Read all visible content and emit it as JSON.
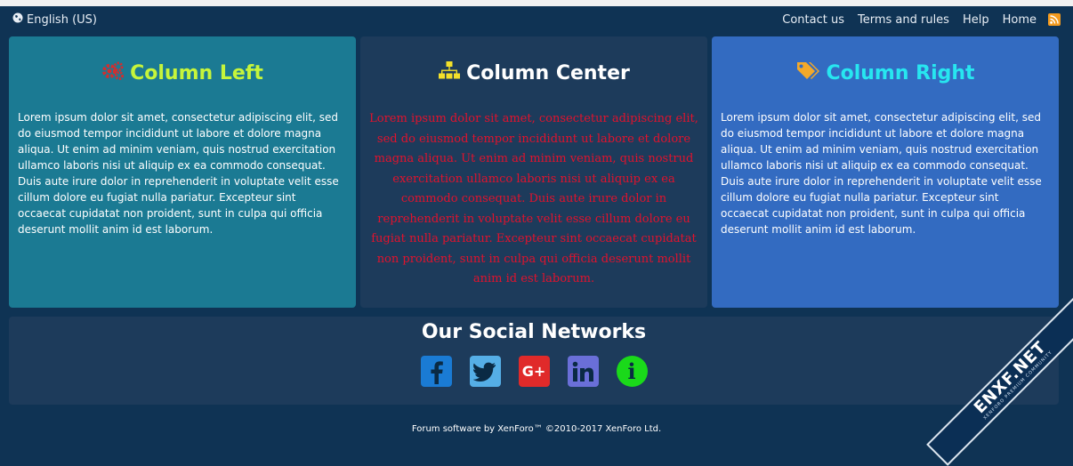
{
  "topbar": {
    "language": "English (US)",
    "links": [
      "Contact us",
      "Terms and rules",
      "Help",
      "Home"
    ]
  },
  "columns": {
    "left": {
      "title": "Column Left",
      "icon": "gears-icon",
      "text": "Lorem ipsum dolor sit amet, consectetur adipiscing elit, sed do eiusmod tempor incididunt ut labore et dolore magna aliqua. Ut enim ad minim veniam, quis nostrud exercitation ullamco laboris nisi ut aliquip ex ea commodo consequat. Duis aute irure dolor in reprehenderit in voluptate velit esse cillum dolore eu fugiat nulla pariatur. Excepteur sint occaecat cupidatat non proident, sunt in culpa qui officia deserunt mollit anim id est laborum."
    },
    "center": {
      "title": "Column Center",
      "icon": "sitemap-icon",
      "text": "Lorem ipsum dolor sit amet, consectetur adipiscing elit, sed do eiusmod tempor incididunt ut labore et dolore magna aliqua. Ut enim ad minim veniam, quis nostrud exercitation ullamco laboris nisi ut aliquip ex ea commodo consequat. Duis aute irure dolor in reprehenderit in voluptate velit esse cillum dolore eu fugiat nulla pariatur. Excepteur sint occaecat cupidatat non proident, sunt in culpa qui officia deserunt mollit anim id est laborum."
    },
    "right": {
      "title": "Column Right",
      "icon": "tags-icon",
      "text": "Lorem ipsum dolor sit amet, consectetur adipiscing elit, sed do eiusmod tempor incididunt ut labore et dolore magna aliqua. Ut enim ad minim veniam, quis nostrud exercitation ullamco laboris nisi ut aliquip ex ea commodo consequat. Duis aute irure dolor in reprehenderit in voluptate velit esse cillum dolore eu fugiat nulla pariatur. Excepteur sint occaecat cupidatat non proident, sunt in culpa qui officia deserunt mollit anim id est laborum."
    }
  },
  "social": {
    "title": "Our Social Networks",
    "gplus_label": "G+",
    "info_label": "i"
  },
  "footer": {
    "text": "Forum software by XenForo™ ©2010-2017 XenForo Ltd."
  },
  "watermark": {
    "brand": "ENXF.NET",
    "tagline": "XENFORO PREMIUM COMMUNITY"
  },
  "colors": {
    "background": "#0f3354",
    "column_left": "#1b7a93",
    "column_center": "#1d3b5b",
    "column_right": "#336bc1",
    "left_title": "#c6f53b",
    "right_title": "#27e6f0",
    "center_text": "#e2122d"
  }
}
